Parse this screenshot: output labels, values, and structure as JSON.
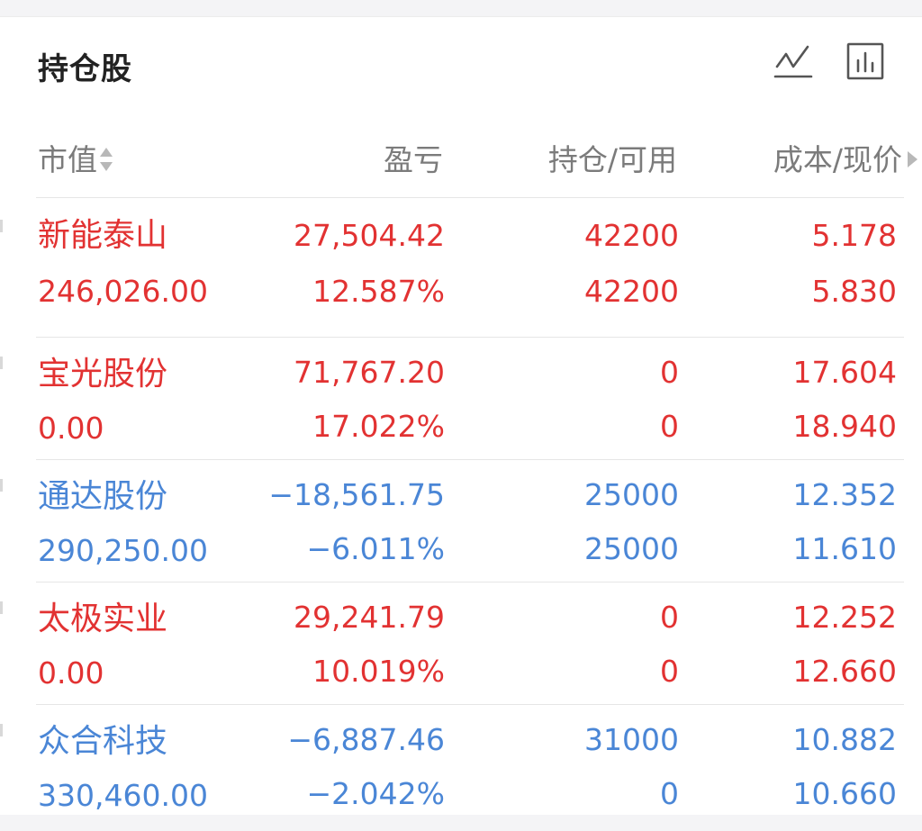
{
  "header": {
    "title": "持仓股"
  },
  "toolbar": {
    "icons": [
      "line-chart-icon",
      "bar-chart-icon"
    ]
  },
  "columns": {
    "market_value": "市值",
    "profit_loss": "盈亏",
    "position_available": "持仓/可用",
    "cost_price": "成本/现价"
  },
  "colors": {
    "up": "#e23232",
    "down": "#4a86d6",
    "header_text": "#7b7b7b"
  },
  "holdings": [
    {
      "name": "新能泰山",
      "market_value": "246,026.00",
      "pl_amount": "27,504.42",
      "pl_percent": "12.587%",
      "position": "42200",
      "available": "42200",
      "cost": "5.178",
      "price": "5.830",
      "trend": "up"
    },
    {
      "name": "宝光股份",
      "market_value": "0.00",
      "pl_amount": "71,767.20",
      "pl_percent": "17.022%",
      "position": "0",
      "available": "0",
      "cost": "17.604",
      "price": "18.940",
      "trend": "up"
    },
    {
      "name": "通达股份",
      "market_value": "290,250.00",
      "pl_amount": "−18,561.75",
      "pl_percent": "−6.011%",
      "position": "25000",
      "available": "25000",
      "cost": "12.352",
      "price": "11.610",
      "trend": "down"
    },
    {
      "name": "太极实业",
      "market_value": "0.00",
      "pl_amount": "29,241.79",
      "pl_percent": "10.019%",
      "position": "0",
      "available": "0",
      "cost": "12.252",
      "price": "12.660",
      "trend": "up"
    },
    {
      "name": "众合科技",
      "market_value": "330,460.00",
      "pl_amount": "−6,887.46",
      "pl_percent": "−2.042%",
      "position": "31000",
      "available": "0",
      "cost": "10.882",
      "price": "10.660",
      "trend": "down"
    }
  ]
}
